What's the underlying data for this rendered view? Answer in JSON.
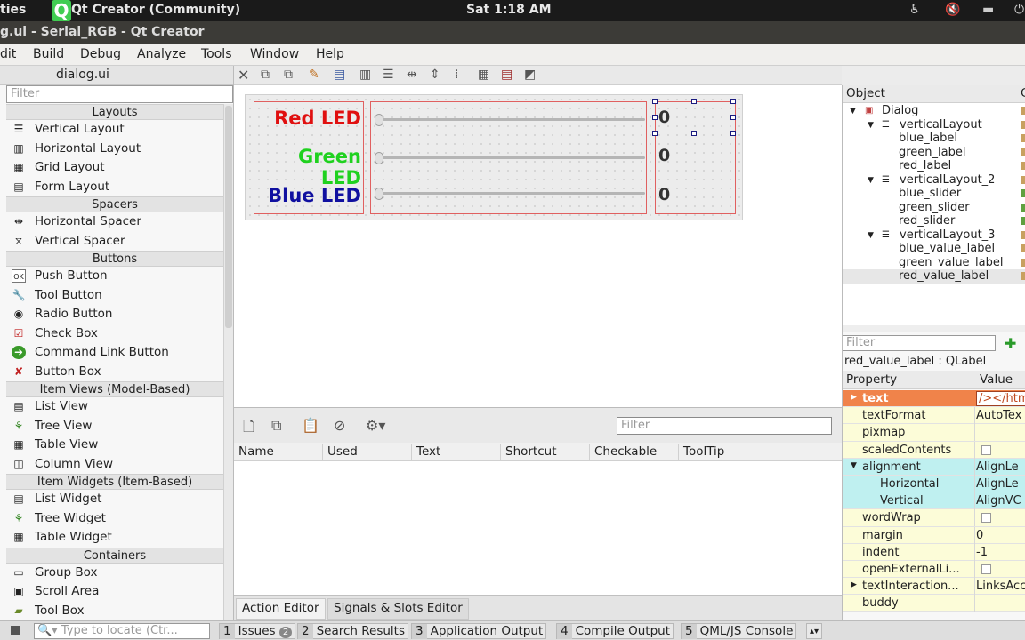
{
  "topbar": {
    "activities_fragment": "ties",
    "app_name": "Qt Creator (Community)",
    "clock": "Sat  1:18 AM"
  },
  "window": {
    "title": "g.ui - Serial_RGB - Qt Creator"
  },
  "menu": [
    "dit",
    "Build",
    "Debug",
    "Analyze",
    "Tools",
    "Window",
    "Help"
  ],
  "left_panel": {
    "file": "dialog.ui",
    "filter_placeholder": "Filter",
    "layouts": {
      "header": "Layouts",
      "items": [
        "Vertical Layout",
        "Horizontal Layout",
        "Grid Layout",
        "Form Layout"
      ]
    },
    "spacers": {
      "header": "Spacers",
      "items": [
        "Horizontal Spacer",
        "Vertical Spacer"
      ]
    },
    "buttons": {
      "header": "Buttons",
      "items": [
        "Push Button",
        "Tool Button",
        "Radio Button",
        "Check Box",
        "Command Link Button",
        "Button Box"
      ]
    },
    "item_views": {
      "header": "Item Views (Model-Based)",
      "items": [
        "List View",
        "Tree View",
        "Table View",
        "Column View"
      ]
    },
    "item_widgets": {
      "header": "Item Widgets (Item-Based)",
      "items": [
        "List Widget",
        "Tree Widget",
        "Table Widget"
      ]
    },
    "containers": {
      "header": "Containers",
      "items": [
        "Group Box",
        "Scroll Area",
        "Tool Box"
      ]
    }
  },
  "form": {
    "labels": [
      "Red LED",
      "Green LED",
      "Blue LED"
    ],
    "label_colors": [
      "#e01010",
      "#1fd11f",
      "#1010a0"
    ],
    "values": [
      "0",
      "0",
      "0"
    ],
    "slider_values": [
      0,
      0,
      0
    ]
  },
  "action_editor": {
    "filter_placeholder": "Filter",
    "columns": [
      "Name",
      "Used",
      "Text",
      "Shortcut",
      "Checkable",
      "ToolTip"
    ],
    "tabs": [
      "Action Editor",
      "Signals & Slots Editor"
    ]
  },
  "object_inspector": {
    "header_object": "Object",
    "header_class_fragment": "C",
    "tree": [
      {
        "name": "Dialog",
        "level": 0,
        "expanded": true
      },
      {
        "name": "verticalLayout",
        "level": 1,
        "expanded": true
      },
      {
        "name": "blue_label",
        "level": 2
      },
      {
        "name": "green_label",
        "level": 2
      },
      {
        "name": "red_label",
        "level": 2
      },
      {
        "name": "verticalLayout_2",
        "level": 1,
        "expanded": true
      },
      {
        "name": "blue_slider",
        "level": 2
      },
      {
        "name": "green_slider",
        "level": 2
      },
      {
        "name": "red_slider",
        "level": 2
      },
      {
        "name": "verticalLayout_3",
        "level": 1,
        "expanded": true
      },
      {
        "name": "blue_value_label",
        "level": 2
      },
      {
        "name": "green_value_label",
        "level": 2
      },
      {
        "name": "red_value_label",
        "level": 2,
        "selected": true
      }
    ]
  },
  "property_editor": {
    "filter_placeholder": "Filter",
    "title": "red_value_label : QLabel",
    "header_property": "Property",
    "header_value": "Value",
    "rows": [
      {
        "name": "text",
        "value": "/></htm"
      },
      {
        "name": "textFormat",
        "value": "AutoTex"
      },
      {
        "name": "pixmap",
        "value": ""
      },
      {
        "name": "scaledContents",
        "value": ""
      },
      {
        "name": "alignment",
        "value": "AlignLe"
      },
      {
        "name": "Horizontal",
        "value": "AlignLe"
      },
      {
        "name": "Vertical",
        "value": "AlignVC"
      },
      {
        "name": "wordWrap",
        "value": ""
      },
      {
        "name": "margin",
        "value": "0"
      },
      {
        "name": "indent",
        "value": "-1"
      },
      {
        "name": "openExternalLi...",
        "value": ""
      },
      {
        "name": "textInteraction...",
        "value": "LinksAcc"
      },
      {
        "name": "buddy",
        "value": ""
      }
    ]
  },
  "statusbar": {
    "locate_placeholder": "Type to locate (Ctr...",
    "tabs": [
      {
        "num": "1",
        "label": "Issues",
        "badge": "2"
      },
      {
        "num": "2",
        "label": "Search Results"
      },
      {
        "num": "3",
        "label": "Application Output"
      },
      {
        "num": "4",
        "label": "Compile Output"
      },
      {
        "num": "5",
        "label": "QML/JS Console"
      }
    ]
  },
  "colors": {
    "accent_orange": "#f0834a",
    "cyan": "#bff0f0",
    "qt_green": "#41cd52"
  }
}
